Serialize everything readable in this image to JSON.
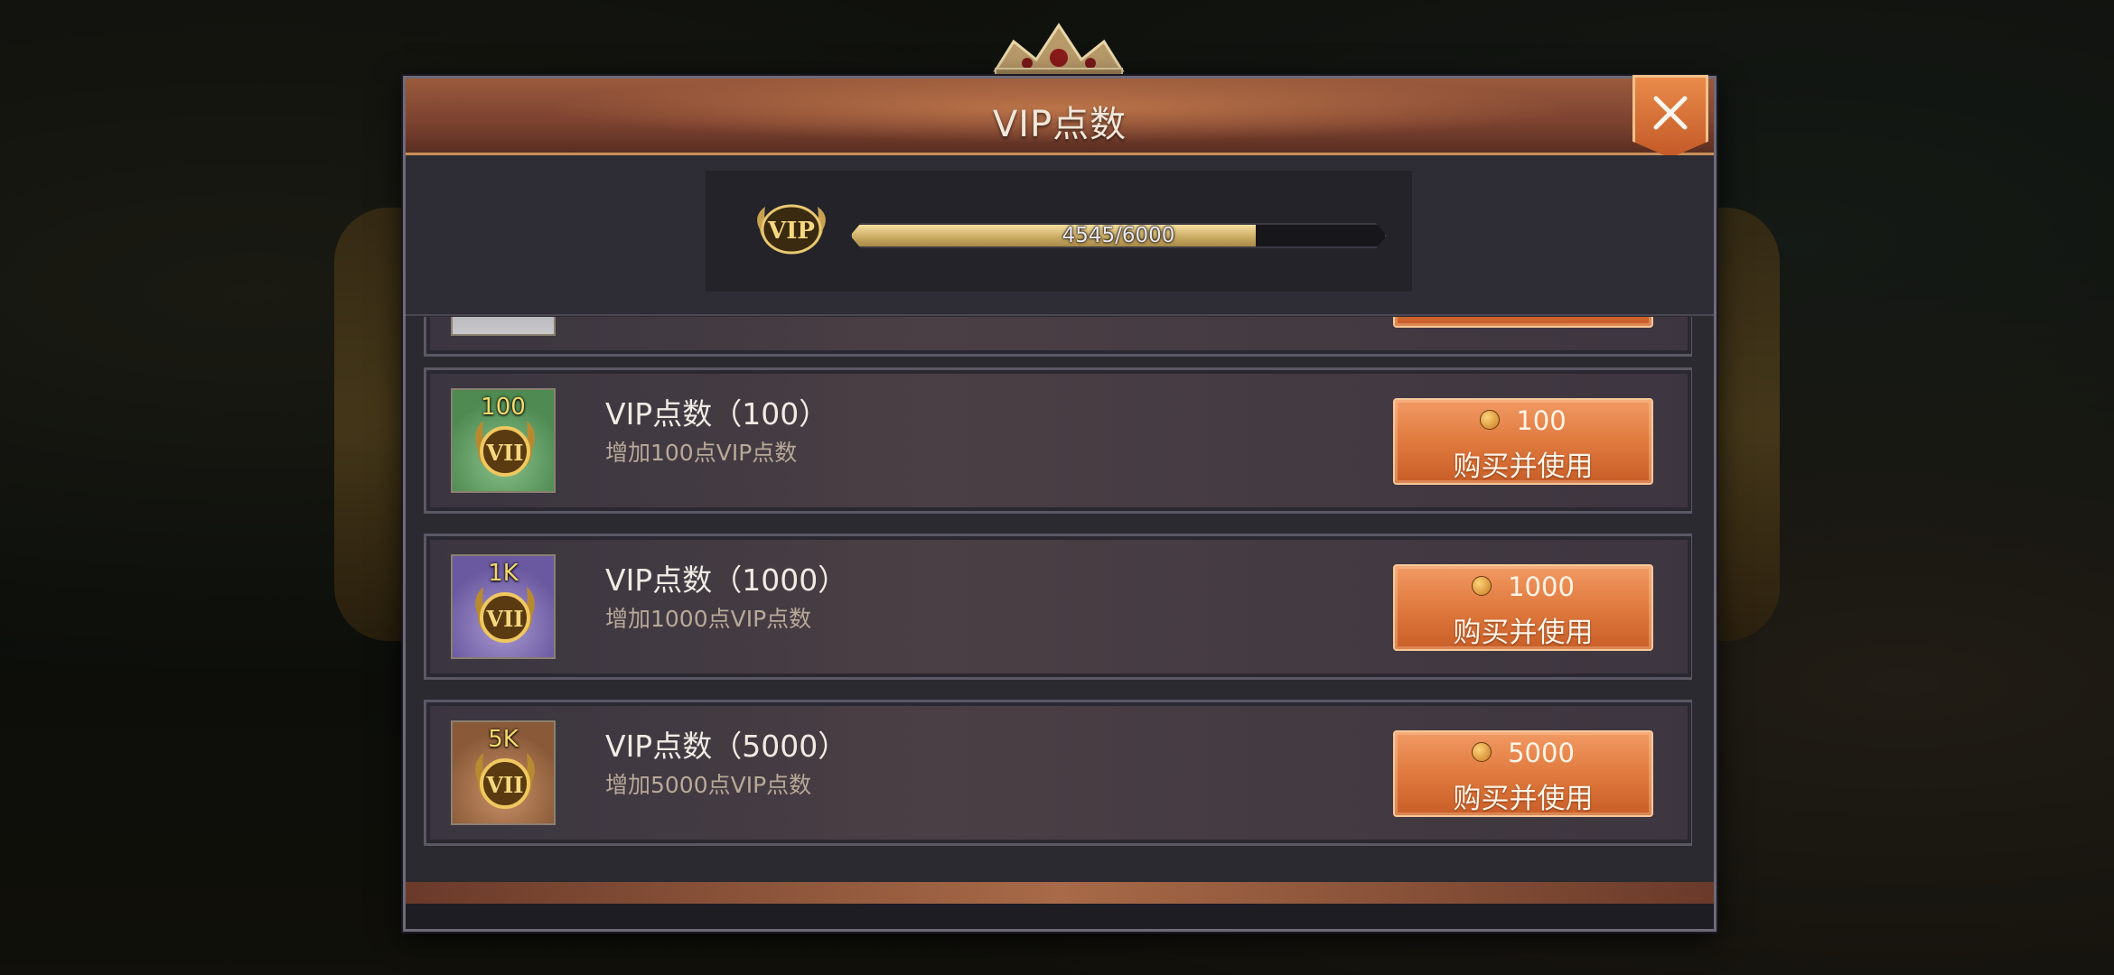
{
  "dialog": {
    "title": "VIP点数",
    "close_icon": "close-x-icon"
  },
  "progress": {
    "badge_text": "VIP",
    "current": 4545,
    "max": 6000,
    "text": "4545/6000"
  },
  "items": [
    {
      "tier": "partial",
      "icon_color": "#9a9a9a"
    },
    {
      "amount_label": "100",
      "name": "VIP点数（100）",
      "desc": "增加100点VIP点数",
      "price": "100",
      "buy_label": "购买并使用",
      "icon_color": "#4e8a52"
    },
    {
      "amount_label": "1K",
      "name": "VIP点数（1000）",
      "desc": "增加1000点VIP点数",
      "price": "1000",
      "buy_label": "购买并使用",
      "icon_color": "#7560a8"
    },
    {
      "amount_label": "5K",
      "name": "VIP点数（5000）",
      "desc": "增加5000点VIP点数",
      "price": "5000",
      "buy_label": "购买并使用",
      "icon_color": "#8a5a38"
    }
  ],
  "colors": {
    "accent": "#e07a3e",
    "gold": "#f4d86a"
  }
}
